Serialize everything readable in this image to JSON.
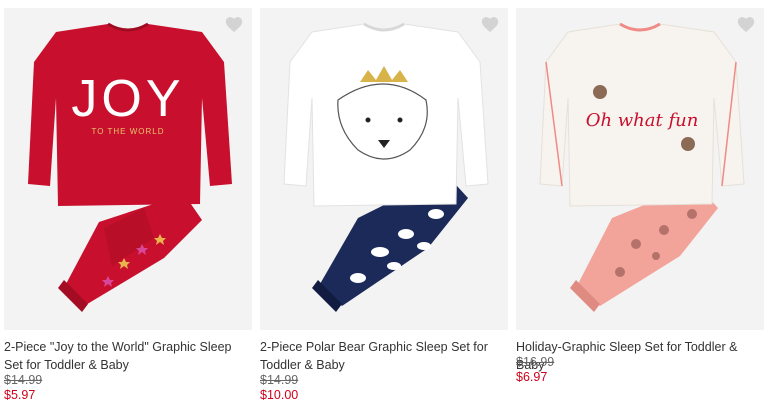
{
  "products": [
    {
      "title": "2-Piece \"Joy to the World\" Graphic Sleep Set for Toddler & Baby",
      "was_price": "$14.99",
      "now_price": "$5.97",
      "shirt_text_main": "JOY",
      "shirt_text_sub": "TO THE WORLD",
      "colors": {
        "shirt": "#c8102e",
        "pants": "#c8102e"
      }
    },
    {
      "title": "2-Piece Polar Bear Graphic Sleep Set for Toddler & Baby",
      "was_price": "$14.99",
      "now_price": "$10.00",
      "colors": {
        "shirt": "#ffffff",
        "pants": "#1c2a5a"
      }
    },
    {
      "title": "Holiday-Graphic Sleep Set for Toddler & Baby",
      "was_price": "$16.99",
      "now_price": "$6.97",
      "shirt_text_main": "Oh what fun",
      "colors": {
        "shirt": "#f7f3ee",
        "pants": "#f2a39a"
      }
    }
  ],
  "icons": {
    "favorite": "heart-icon"
  },
  "colors": {
    "sale_price": "#d0021b",
    "heart": "#d3d3d3"
  }
}
